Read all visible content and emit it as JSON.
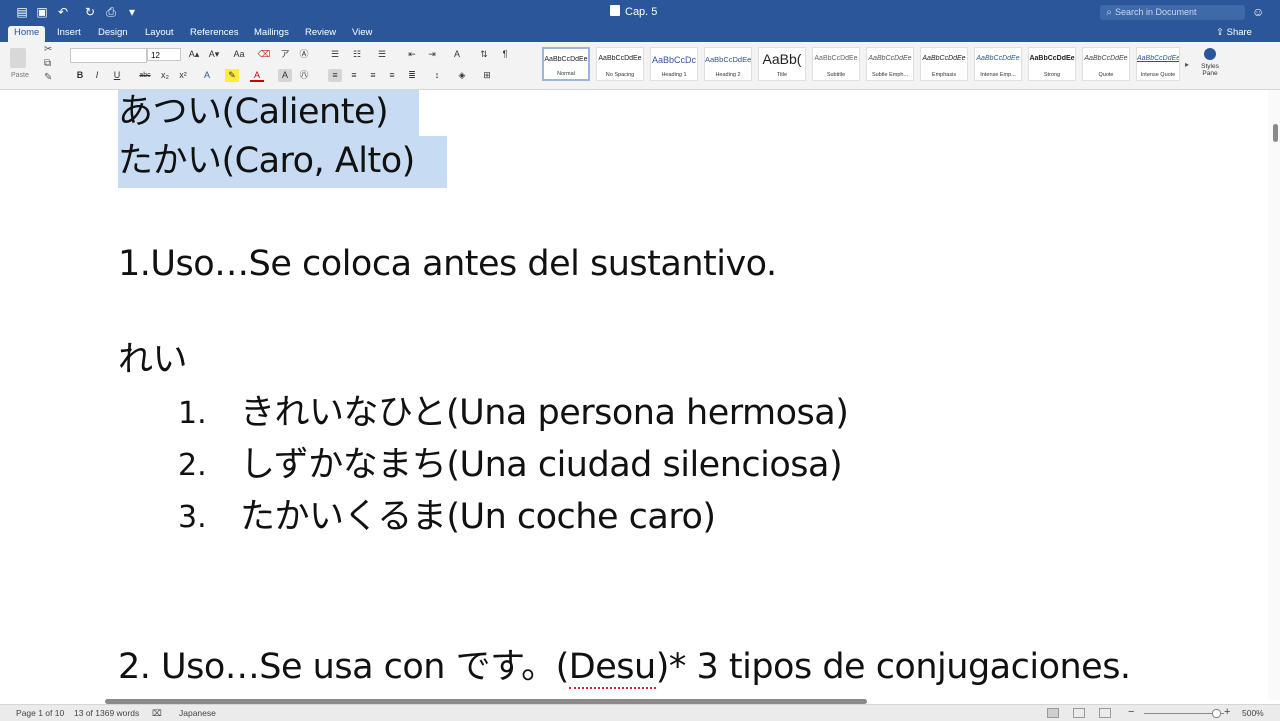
{
  "window": {
    "title": "Cap. 5",
    "search_placeholder": "Search in Document"
  },
  "ribbon_tabs": [
    "Home",
    "Insert",
    "Design",
    "Layout",
    "References",
    "Mailings",
    "Review",
    "View"
  ],
  "share_label": "Share",
  "ribbon": {
    "paste_label": "Paste",
    "font_name": "",
    "font_size": "12",
    "styles_pane_label": "Styles Pane",
    "styles": [
      {
        "preview": "AaBbCcDdEe",
        "label": "Normal"
      },
      {
        "preview": "AaBbCcDdEe",
        "label": "No Spacing"
      },
      {
        "preview": "AaBbCcDc",
        "label": "Heading 1"
      },
      {
        "preview": "AaBbCcDdEe",
        "label": "Heading 2"
      },
      {
        "preview": "AaBb(",
        "label": "Title"
      },
      {
        "preview": "AaBbCcDdEe",
        "label": "Subtitle"
      },
      {
        "preview": "AaBbCcDdEe",
        "label": "Subtle Emph..."
      },
      {
        "preview": "AaBbCcDdEe",
        "label": "Emphasis"
      },
      {
        "preview": "AaBbCcDdEe",
        "label": "Intense Emp..."
      },
      {
        "preview": "AaBbCcDdEe",
        "label": "Strong"
      },
      {
        "preview": "AaBbCcDdEe",
        "label": "Quote"
      },
      {
        "preview": "AaBbCcDdEe",
        "label": "Intense Quote"
      }
    ]
  },
  "document": {
    "line1_jp": "あつい",
    "line1_es": "(Caliente)",
    "line2_jp": "たかい",
    "line2_es": "(Caro, Alto)",
    "use1": "1.Uso…Se coloca antes del sustantivo.",
    "rei": "れい",
    "list": [
      {
        "num": "1.",
        "jp": "きれいなひと",
        "es": "(Una persona hermosa)"
      },
      {
        "num": "2.",
        "jp": "しずかなまち",
        "es": "(Una ciudad silenciosa)"
      },
      {
        "num": "3.",
        "jp": "たかいくるま",
        "es": "(Un coche caro)"
      }
    ],
    "use2_a": "2. Uso…Se usa con ",
    "use2_jp": "です。",
    "use2_desu": "(Desu)",
    "use2_b": "* 3 tipos de conjugaciones."
  },
  "status": {
    "page": "Page 1 of 10",
    "words": "13 of 1369 words",
    "language": "Japanese",
    "zoom": "500%"
  },
  "colors": {
    "accent": "#2b579a",
    "selection": "#c7dbf3"
  }
}
